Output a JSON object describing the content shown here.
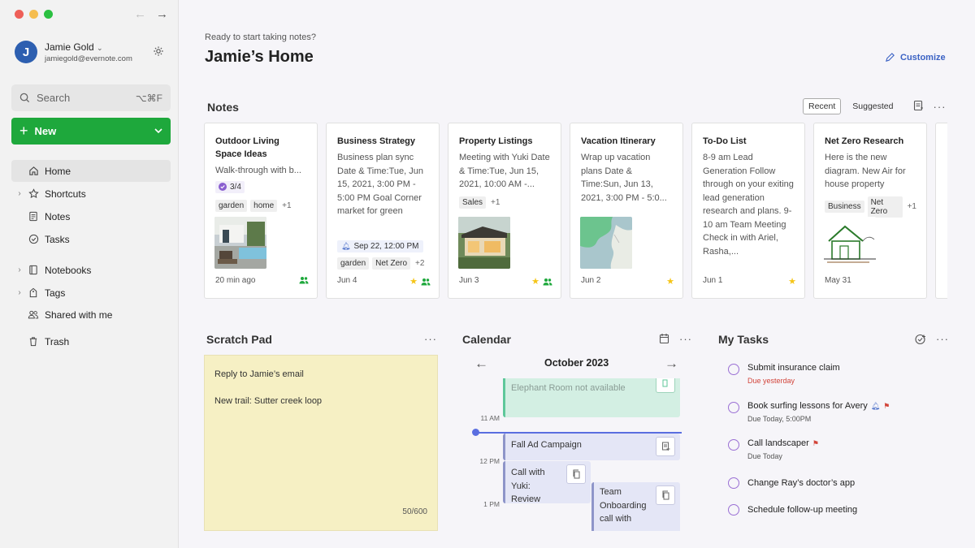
{
  "window": {
    "colors": {
      "close": "#ee5f58",
      "minimize": "#f5bd4f",
      "maximize": "#2bc041"
    }
  },
  "account": {
    "initial": "J",
    "name": "Jamie Gold",
    "email": "jamiegold@evernote.com",
    "avatar_color": "#2d5fb0"
  },
  "search": {
    "placeholder": "Search",
    "shortcut": "⌥⌘F"
  },
  "new_button": {
    "label": "New",
    "color": "#1ea83c"
  },
  "sidebar": {
    "items": [
      {
        "label": "Home",
        "icon": "home-icon",
        "active": true
      },
      {
        "label": "Shortcuts",
        "icon": "star-icon",
        "expandable": true
      },
      {
        "label": "Notes",
        "icon": "note-icon"
      },
      {
        "label": "Tasks",
        "icon": "check-circle-icon"
      },
      {
        "label": "Notebooks",
        "icon": "notebook-icon",
        "expandable": true
      },
      {
        "label": "Tags",
        "icon": "tag-icon",
        "expandable": true
      },
      {
        "label": "Shared with me",
        "icon": "people-icon"
      },
      {
        "label": "Trash",
        "icon": "trash-icon"
      }
    ]
  },
  "header": {
    "greeting": "Ready to start taking notes?",
    "title": "Jamie’s Home",
    "customize": "Customize"
  },
  "notes": {
    "title": "Notes",
    "tabs": [
      "Recent",
      "Suggested"
    ],
    "active_tab": "Recent",
    "cards": [
      {
        "title": "Outdoor Living Space Ideas",
        "snippet": "Walk-through with b...",
        "task_count": "3/4",
        "tags": [
          "garden",
          "home"
        ],
        "more_tags": "+1",
        "date": "20 min ago",
        "shared": true,
        "starred": false,
        "thumb": "patio-photo"
      },
      {
        "title": "Business Strategy",
        "snippet": "Business plan sync Date & Time:Tue, Jun 15, 2021, 3:00 PM - 5:00 PM Goal Corner market for green",
        "reminder": "Sep 22, 12:00 PM",
        "tags": [
          "garden",
          "Net Zero"
        ],
        "more_tags": "+2",
        "date": "Jun 4",
        "shared": true,
        "starred": true
      },
      {
        "title": "Property Listings",
        "snippet": "Meeting with Yuki Date & Time:Tue, Jun 15, 2021, 10:00 AM -...",
        "tags": [
          "Sales"
        ],
        "more_tags": "+1",
        "date": "Jun 3",
        "shared": true,
        "starred": true,
        "thumb": "house-photo"
      },
      {
        "title": "Vacation Itinerary",
        "snippet": "Wrap up vacation plans Date & Time:Sun, Jun 13, 2021, 3:00 PM - 5:0...",
        "date": "Jun 2",
        "shared": false,
        "starred": true,
        "thumb": "map-image"
      },
      {
        "title": "To-Do List",
        "snippet": "8-9 am Lead Generation Follow through on your exiting lead generation research and plans. 9-10 am Team Meeting Check in with Ariel, Rasha,...",
        "date": "Jun 1",
        "shared": false,
        "starred": true
      },
      {
        "title": "Net Zero Research",
        "snippet": "Here is the new diagram. New Air for house property",
        "tags": [
          "Business",
          "Net Zero"
        ],
        "more_tags": "+1",
        "date": "May 31",
        "shared": false,
        "starred": false,
        "thumb": "house-sketch"
      }
    ]
  },
  "scratch_pad": {
    "title": "Scratch Pad",
    "line1": "Reply to Jamie’s email",
    "line2": "New trail: Sutter creek loop",
    "count": "50/600",
    "color": "#f6f0c4"
  },
  "calendar": {
    "title": "Calendar",
    "month": "October 2023",
    "times": [
      "11 AM",
      "12 PM",
      "1 PM"
    ],
    "events": [
      {
        "title": "Elephant Room not available"
      },
      {
        "title": "Fall Ad Campaign"
      },
      {
        "title": "Call with Yuki: Review"
      },
      {
        "title": "Team Onboarding call with"
      }
    ]
  },
  "my_tasks": {
    "title": "My Tasks",
    "tasks": [
      {
        "name": "Submit insurance claim",
        "due": "Due yesterday",
        "overdue": true
      },
      {
        "name": "Book surfing lessons for Avery",
        "due": "Due Today, 5:00PM",
        "reminder": true,
        "flag": true
      },
      {
        "name": "Call landscaper",
        "due": "Due Today",
        "flag": true
      },
      {
        "name": "Change Ray’s doctor’s app"
      },
      {
        "name": "Schedule follow-up meeting"
      }
    ]
  }
}
